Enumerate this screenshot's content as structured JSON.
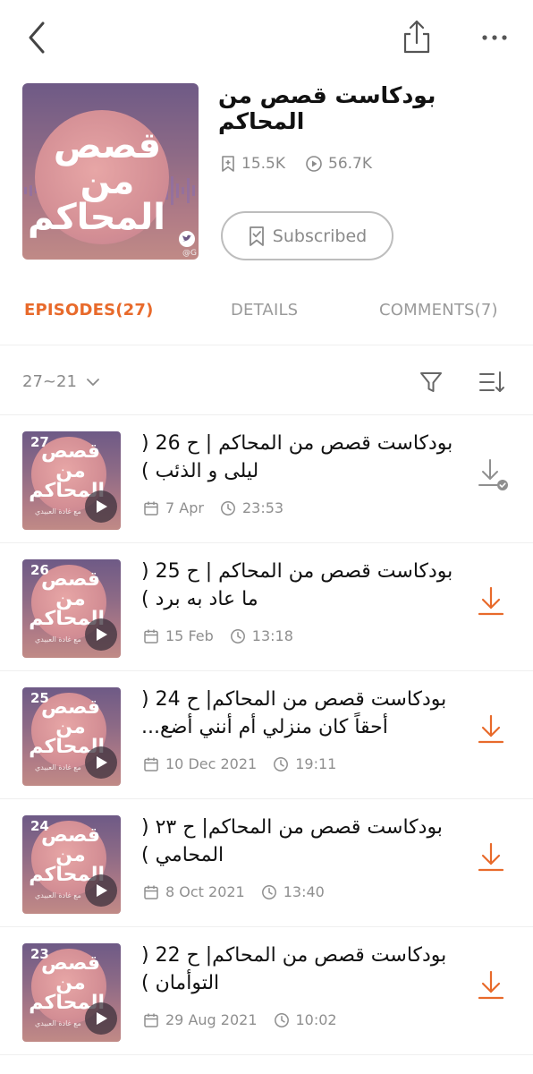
{
  "colors": {
    "accent": "#e86a2b",
    "muted": "#8a8a8a",
    "divider": "#efefef"
  },
  "topbar": {
    "back_icon": "chevron-left-icon",
    "share_icon": "share-icon",
    "more_icon": "more-horizontal-icon"
  },
  "podcast": {
    "title": "بودكاست قصص من المحاكم",
    "cover_text": "قصص من المحاكم",
    "cover_handle": "@G",
    "subscribers": "15.5K",
    "plays": "56.7K",
    "subscribe_label": "Subscribed"
  },
  "tabs": [
    {
      "label": "EPISODES(27)",
      "active": true
    },
    {
      "label": "DETAILS",
      "active": false
    },
    {
      "label": "COMMENTS(7)",
      "active": false
    }
  ],
  "filter": {
    "range": "27~21"
  },
  "episodes": [
    {
      "number": "27",
      "title": "بودكاست قصص من المحاكم | ح 26 ( ليلى و الذئب )",
      "date": "7 Apr",
      "duration": "23:53",
      "downloaded": true,
      "thumb_sub": "مع غادة العبيدي"
    },
    {
      "number": "26",
      "title": "بودكاست قصص من المحاكم | ح 25 ( ما عاد به برد )",
      "date": "15 Feb",
      "duration": "13:18",
      "downloaded": false,
      "thumb_sub": "مع غادة العبيدي"
    },
    {
      "number": "25",
      "title": "بودكاست قصص من المحاكم| ح 24 ( أحقاً كان منزلي أم أنني أضع...",
      "date": "10 Dec 2021",
      "duration": "19:11",
      "downloaded": false,
      "thumb_sub": "مع غادة العبيدي"
    },
    {
      "number": "24",
      "title": "بودكاست قصص من المحاكم| ح ٢٣ ( المحامي )",
      "date": "8 Oct 2021",
      "duration": "13:40",
      "downloaded": false,
      "thumb_sub": "مع غادة العبيدي"
    },
    {
      "number": "23",
      "title": "بودكاست قصص من المحاكم| ح 22 ( التوأمان )",
      "date": "29 Aug 2021",
      "duration": "10:02",
      "downloaded": false,
      "thumb_sub": "مع غادة العبيدي"
    }
  ]
}
